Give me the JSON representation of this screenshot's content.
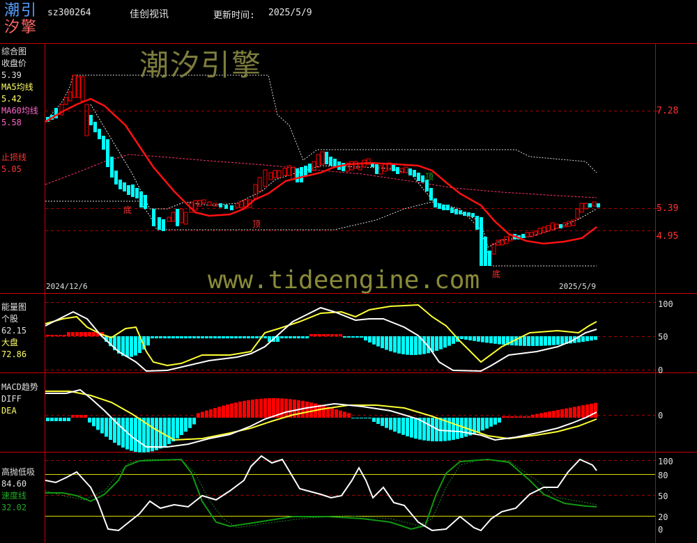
{
  "header": {
    "logo": {
      "line1": "潮引",
      "line2": "汐擎"
    },
    "code": "sz300264",
    "name": "佳创视讯",
    "update_label": "更新时间:",
    "update_date": "2025/5/9"
  },
  "watermark": {
    "cn": "潮汐引擎",
    "url": "www.tideengine.com"
  },
  "colors": {
    "up": "#ff0000",
    "down": "#00ffff",
    "ma5": "#ffff66",
    "ma60": "#ff66cc",
    "stop": "#ff3333",
    "frame": "#cc0000"
  },
  "main_panel": {
    "title": "综合图",
    "close_label": "收盘价",
    "close_value": "5.39",
    "ma5_label": "MA5均线",
    "ma5_value": "5.42",
    "ma60_label": "MA60均线",
    "ma60_value": "5.58",
    "stop_label": "止损线",
    "stop_value": "5.05",
    "price_ticks": [
      "7.28",
      "5.39",
      "4.95"
    ],
    "start_date": "2024/12/6",
    "end_date": "2025/5/9",
    "markers": [
      "底",
      "顶",
      "顶",
      "底"
    ]
  },
  "energy_panel": {
    "title": "能量图",
    "stock_label": "个股",
    "stock_value": "62.15",
    "market_label": "大盘",
    "market_value": "72.86",
    "ticks": [
      "100",
      "50",
      "0"
    ]
  },
  "macd_panel": {
    "title": "MACD趋势",
    "diff_label": "DIFF",
    "dea_label": "DEA",
    "ticks": [
      "0"
    ]
  },
  "kdj_panel": {
    "title": "高抛低吸",
    "value": "84.60",
    "speed_label": "速度线",
    "speed_value": "32.02",
    "ticks": [
      "100",
      "80",
      "50",
      "20",
      "0"
    ]
  }
}
